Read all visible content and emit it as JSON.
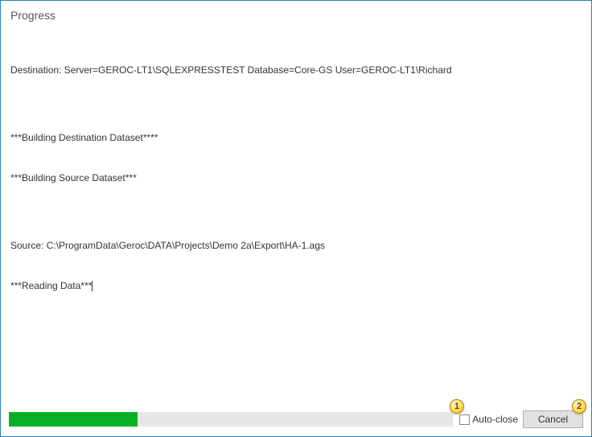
{
  "title": "Progress",
  "log": {
    "line1": "Destination: Server=GEROC-LT1\\SQLEXPRESSTEST Database=Core-GS User=GEROC-LT1\\Richard",
    "blank1": "",
    "line2": "***Building Destination Dataset****",
    "line3": "***Building Source Dataset***",
    "blank2": "",
    "line4": "Source: C:\\ProgramData\\Geroc\\DATA\\Projects\\Demo 2a\\Export\\HA-1.ags",
    "line5": "***Reading Data***"
  },
  "progress": {
    "percent": 29
  },
  "autoclose": {
    "label": "Auto-close",
    "checked": false
  },
  "cancel": {
    "label": "Cancel"
  },
  "callouts": {
    "c1": "1",
    "c2": "2"
  }
}
